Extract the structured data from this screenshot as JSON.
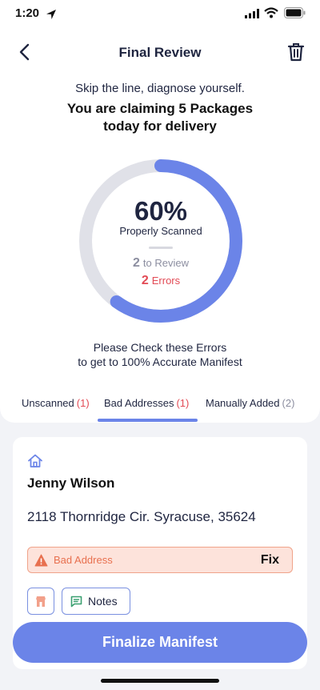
{
  "status": {
    "time": "1:20"
  },
  "header": {
    "title": "Final Review"
  },
  "summary": {
    "subtitle": "Skip the line, diagnose yourself.",
    "claim": "You are claiming 5 Packages today for delivery"
  },
  "progress": {
    "value": 0.6,
    "percent_label": "60%",
    "label": "Properly Scanned",
    "review_count": "2",
    "review_label": "to Review",
    "error_count": "2",
    "error_label": "Errors"
  },
  "instruction": {
    "line1": "Please Check these Errors",
    "line2": "to get to 100% Accurate Manifest"
  },
  "tabs": [
    {
      "label": "Unscanned",
      "count": "(1)"
    },
    {
      "label": "Bad Addresses",
      "count": "(1)"
    },
    {
      "label": "Manually Added",
      "count": "(2)"
    }
  ],
  "card": {
    "name": "Jenny Wilson",
    "address": "2118 Thornridge Cir. Syracuse, 35624",
    "issue_label": "Bad Address",
    "fix_label": "Fix",
    "notes_label": "Notes"
  },
  "footer": {
    "finalize_label": "Finalize Manifest"
  },
  "colors": {
    "accent": "#6b84e8",
    "error": "#e24a55",
    "warning": "#e8704f",
    "track": "#e0e1e8"
  },
  "icons": [
    "location-arrow-icon",
    "signal-icon",
    "wifi-icon",
    "battery-icon",
    "back-chevron-icon",
    "trash-icon",
    "home-icon",
    "warning-icon",
    "storefront-icon",
    "notes-icon"
  ]
}
